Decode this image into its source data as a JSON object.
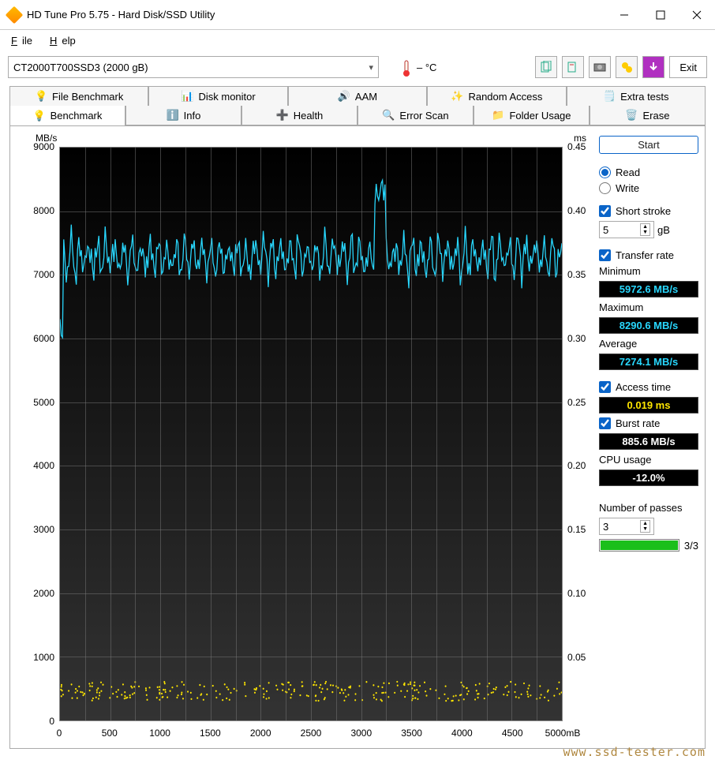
{
  "titlebar": {
    "title": "HD Tune Pro 5.75 - Hard Disk/SSD Utility"
  },
  "menubar": {
    "file": "File",
    "help": "Help"
  },
  "toolbar": {
    "drive": "CT2000T700SSD3 (2000 gB)",
    "temp": "– °C",
    "exit": "Exit"
  },
  "tabs_top": [
    {
      "label": "File Benchmark"
    },
    {
      "label": "Disk monitor"
    },
    {
      "label": "AAM"
    },
    {
      "label": "Random Access"
    },
    {
      "label": "Extra tests"
    }
  ],
  "tabs_bottom": [
    {
      "label": "Benchmark"
    },
    {
      "label": "Info"
    },
    {
      "label": "Health"
    },
    {
      "label": "Error Scan"
    },
    {
      "label": "Folder Usage"
    },
    {
      "label": "Erase"
    }
  ],
  "chart_data": {
    "type": "line",
    "title": "",
    "ylabel_left": "MB/s",
    "ylabel_right": "ms",
    "x_unit": "5000mB",
    "y_left_ticks": [
      9000,
      8000,
      7000,
      6000,
      5000,
      4000,
      3000,
      2000,
      1000,
      0
    ],
    "y_right_ticks": [
      0.45,
      0.4,
      0.35,
      0.3,
      0.25,
      0.2,
      0.15,
      0.1,
      0.05
    ],
    "x_ticks": [
      0,
      500,
      1000,
      1500,
      2000,
      2500,
      3000,
      3500,
      4000,
      4500
    ],
    "x_range": [
      0,
      5000
    ],
    "y_left_range": [
      0,
      9000
    ],
    "y_right_range": [
      0,
      0.45
    ],
    "series": [
      {
        "name": "Transfer rate",
        "color": "#28d8ff",
        "approx_mean": 7274,
        "approx_min": 5973,
        "approx_max": 8291
      },
      {
        "name": "Access time",
        "color": "#ffe600",
        "approx_mean_ms": 0.019
      }
    ]
  },
  "panel": {
    "start": "Start",
    "read": "Read",
    "write": "Write",
    "short_stroke": "Short stroke",
    "short_val": "5",
    "short_unit": "gB",
    "transfer_rate": "Transfer rate",
    "minimum_label": "Minimum",
    "minimum_val": "5972.6 MB/s",
    "maximum_label": "Maximum",
    "maximum_val": "8290.6 MB/s",
    "average_label": "Average",
    "average_val": "7274.1 MB/s",
    "access_time": "Access time",
    "access_val": "0.019 ms",
    "burst_rate": "Burst rate",
    "burst_val": "885.6 MB/s",
    "cpu_label": "CPU usage",
    "cpu_val": "-12.0%",
    "passes_label": "Number of passes",
    "passes_val": "3",
    "passes_progress": "3/3"
  },
  "watermark": "www.ssd-tester.com"
}
